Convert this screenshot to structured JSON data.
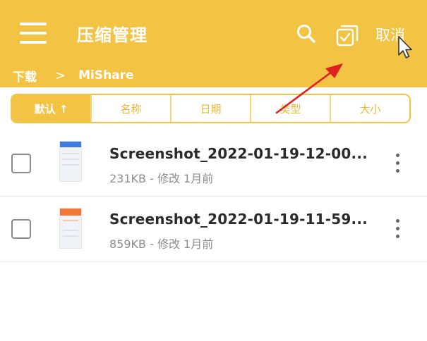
{
  "header": {
    "title": "压缩管理",
    "cancel_label": "取消",
    "menu_icon": "hamburger-menu-icon",
    "search_icon": "search-icon",
    "select_icon": "select-all-checkbox-icon"
  },
  "breadcrumb": {
    "items": [
      "下载",
      "MiShare"
    ],
    "separator": ">"
  },
  "sort_tabs": [
    {
      "label": "默认 ↑",
      "active": true
    },
    {
      "label": "名称",
      "active": false
    },
    {
      "label": "日期",
      "active": false
    },
    {
      "label": "类型",
      "active": false
    },
    {
      "label": "大小",
      "active": false
    }
  ],
  "files": [
    {
      "name": "Screenshot_2022-01-19-12-00...",
      "meta": "231KB - 修改 1月前",
      "thumb_accent": "#3b7de0"
    },
    {
      "name": "Screenshot_2022-01-19-11-59...",
      "meta": "859KB - 修改 1月前",
      "thumb_accent": "#ee7a3a"
    }
  ],
  "colors": {
    "accent": "#f3c443",
    "annotation_arrow": "#e02020"
  }
}
